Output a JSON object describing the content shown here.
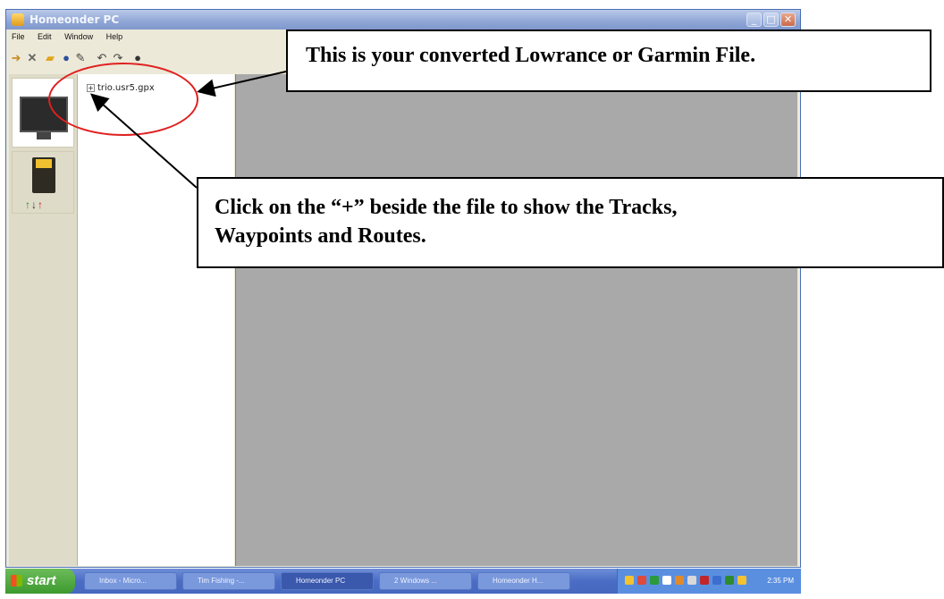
{
  "window": {
    "title": "Homeonder PC",
    "buttons": {
      "minimize": "_",
      "maximize": "□",
      "close": "✕"
    }
  },
  "menu": {
    "items": [
      "File",
      "Edit",
      "Window",
      "Help"
    ]
  },
  "toolbar": {
    "icons": [
      "import-icon",
      "delete-icon",
      "folder-icon",
      "globe-icon",
      "edit-icon",
      "undo-icon",
      "redo-icon",
      "settings-icon"
    ]
  },
  "tree": {
    "expander": "+",
    "file_name": "trio.usr5.gpx"
  },
  "taskbar": {
    "start_label": "start",
    "tasks": [
      "Inbox - Micro...",
      "Tim Fishing -...",
      "Homeonder PC",
      "2 Windows ...",
      "Homeonder H..."
    ],
    "clock": "2:35 PM"
  },
  "annotations": {
    "callout_file": "This is your converted Lowrance or Garmin File.",
    "callout_expand_line1": "Click on the “+” beside the file to show the Tracks,",
    "callout_expand_line2": "Waypoints and Routes."
  },
  "colors": {
    "highlight_circle": "#e02020",
    "work_area": "#a9a9a9",
    "xp_taskbar": "#4a6cc4",
    "start_button": "#3c9a2e"
  }
}
